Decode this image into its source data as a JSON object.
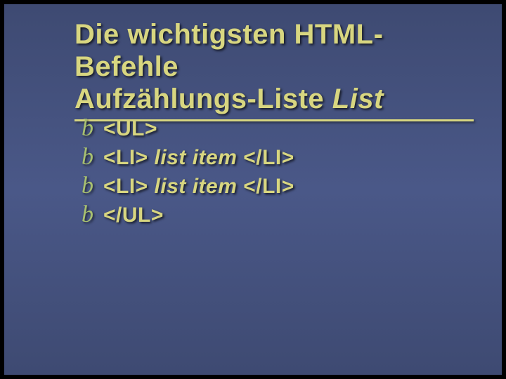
{
  "title": {
    "line1": "Die wichtigsten HTML-Befehle",
    "line2_a": "Aufzählungs-Liste ",
    "line2_b": "List"
  },
  "bullets": [
    {
      "parts": [
        {
          "t": "<UL>",
          "emph": false
        }
      ]
    },
    {
      "parts": [
        {
          "t": "<LI> ",
          "emph": false
        },
        {
          "t": "list item ",
          "emph": true
        },
        {
          "t": "</LI>",
          "emph": false
        }
      ]
    },
    {
      "parts": [
        {
          "t": "<LI> ",
          "emph": false
        },
        {
          "t": "list item ",
          "emph": true
        },
        {
          "t": "</LI>",
          "emph": false
        }
      ]
    },
    {
      "parts": [
        {
          "t": "</UL>",
          "emph": false
        }
      ]
    }
  ],
  "bullet_glyph": "b"
}
